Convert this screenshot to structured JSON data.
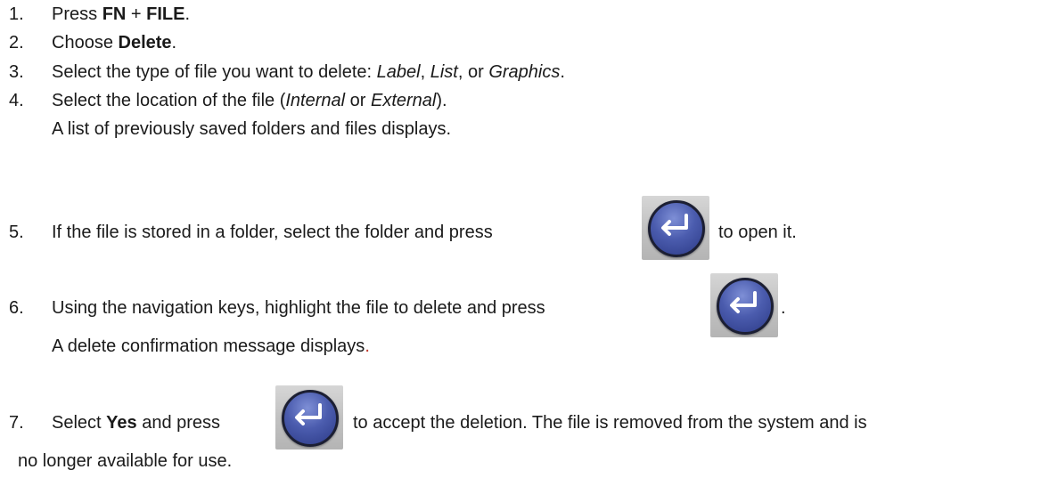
{
  "steps": [
    {
      "num": "1.",
      "parts": [
        "Press ",
        "FN",
        " + ",
        "FILE",
        "."
      ]
    },
    {
      "num": "2.",
      "parts": [
        "Choose ",
        "Delete",
        "."
      ]
    },
    {
      "num": "3.",
      "parts": [
        "Select the type of file you want to delete: ",
        "Label",
        ", ",
        "List",
        ", or ",
        "Graphics",
        "."
      ]
    },
    {
      "num": "4.",
      "parts": [
        "Select the location of the file (",
        "Internal",
        " or ",
        "External",
        ")."
      ],
      "result": "A list of previously saved folders and files displays."
    },
    {
      "num": "5.",
      "before_key": "If the file is stored in a folder, select the folder and press",
      "after_key": "to open it."
    },
    {
      "num": "6.",
      "before_key": "Using the navigation keys, highlight the file to delete and press",
      "after_key": ".",
      "result_main": "A delete confirmation message displays",
      "result_end": "."
    },
    {
      "num": "7.",
      "parts": [
        "Select ",
        "Yes",
        " and press"
      ],
      "after_key": "to accept the deletion. The file is removed from the system and is",
      "continuation": "no longer available for use."
    }
  ],
  "icons": {
    "enter_key": "enter-key-icon"
  },
  "colors": {
    "text": "#1a1a1a",
    "period_accent": "#c0392b",
    "key_blue": "#4b5cae"
  }
}
